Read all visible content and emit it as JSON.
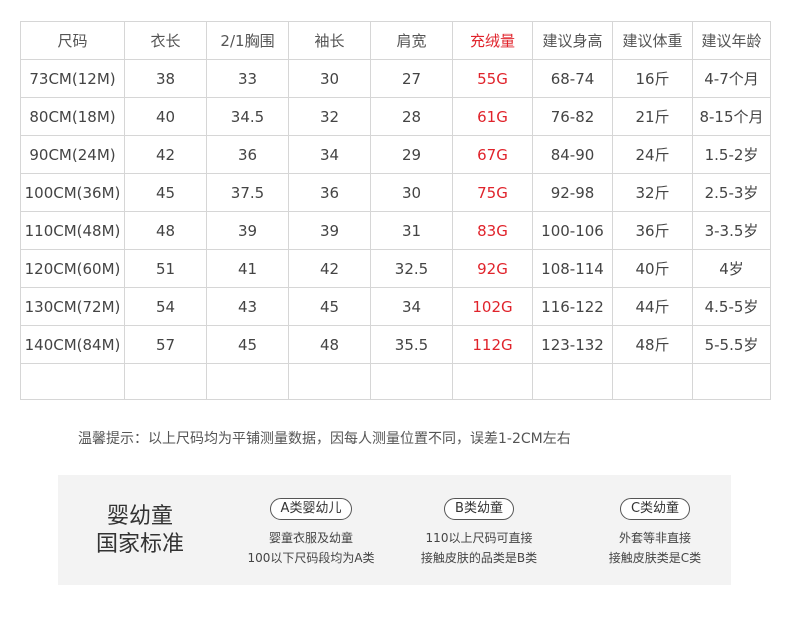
{
  "table": {
    "headers": [
      "尺码",
      "衣长",
      "2/1胸围",
      "袖长",
      "肩宽",
      "充绒量",
      "建议身高",
      "建议体重",
      "建议年龄"
    ],
    "rows": [
      [
        "73CM(12M)",
        "38",
        "33",
        "30",
        "27",
        "55G",
        "68-74",
        "16斤",
        "4-7个月"
      ],
      [
        "80CM(18M)",
        "40",
        "34.5",
        "32",
        "28",
        "61G",
        "76-82",
        "21斤",
        "8-15个月"
      ],
      [
        "90CM(24M)",
        "42",
        "36",
        "34",
        "29",
        "67G",
        "84-90",
        "24斤",
        "1.5-2岁"
      ],
      [
        "100CM(36M)",
        "45",
        "37.5",
        "36",
        "30",
        "75G",
        "92-98",
        "32斤",
        "2.5-3岁"
      ],
      [
        "110CM(48M)",
        "48",
        "39",
        "39",
        "31",
        "83G",
        "100-106",
        "36斤",
        "3-3.5岁"
      ],
      [
        "120CM(60M)",
        "51",
        "41",
        "42",
        "32.5",
        "92G",
        "108-114",
        "40斤",
        "4岁"
      ],
      [
        "130CM(72M)",
        "54",
        "43",
        "45",
        "34",
        "102G",
        "116-122",
        "44斤",
        "4.5-5岁"
      ],
      [
        "140CM(84M)",
        "57",
        "45",
        "48",
        "35.5",
        "112G",
        "123-132",
        "48斤",
        "5-5.5岁"
      ]
    ],
    "highlight_color": "#e0232b"
  },
  "tip": "温馨提示：以上尺码均为平铺测量数据，因每人测量位置不同，误差1-2CM左右",
  "standard": {
    "title_line1": "婴幼童",
    "title_line2": "国家标准",
    "categories": [
      {
        "label": "A类婴幼儿",
        "line1": "婴童衣服及幼童",
        "line2": "100以下尺码段均为A类"
      },
      {
        "label": "B类幼童",
        "line1": "110以上尺码可直接",
        "line2": "接触皮肤的品类是B类"
      },
      {
        "label": "C类幼童",
        "line1": "外套等非直接",
        "line2": "接触皮肤类是C类"
      }
    ]
  }
}
